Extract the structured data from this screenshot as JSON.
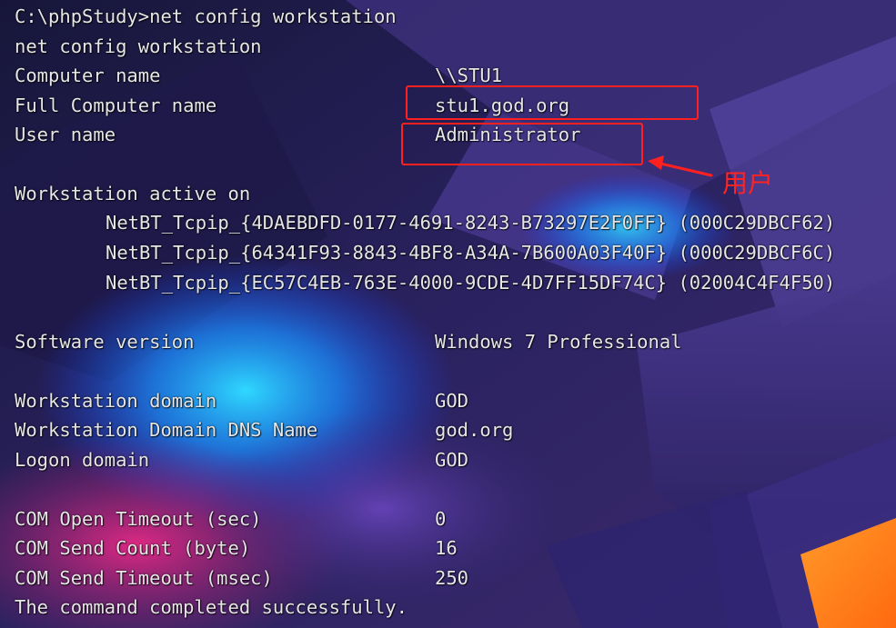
{
  "console": {
    "prompt": "C:\\phpStudy>net config workstation",
    "echo": "net config workstation",
    "rows": [
      {
        "label": "Computer name",
        "value": "\\\\STU1"
      },
      {
        "label": "Full Computer name",
        "value": "stu1.god.org"
      },
      {
        "label": "User name",
        "value": "Administrator"
      }
    ],
    "active_header": "Workstation active on",
    "adapters": [
      "NetBT_Tcpip_{4DAEBDFD-0177-4691-8243-B73297E2F0FF} (000C29DBCF62)",
      "NetBT_Tcpip_{64341F93-8843-4BF8-A34A-7B600A03F40F} (000C29DBCF6C)",
      "NetBT_Tcpip_{EC57C4EB-763E-4000-9CDE-4D7FF15DF74C} (02004C4F4F50)"
    ],
    "software": {
      "label": "Software version",
      "value": "Windows 7 Professional"
    },
    "domain_rows": [
      {
        "label": "Workstation domain",
        "value": "GOD"
      },
      {
        "label": "Workstation Domain DNS Name",
        "value": "god.org"
      },
      {
        "label": "Logon domain",
        "value": "GOD"
      }
    ],
    "com_rows": [
      {
        "label": "COM Open Timeout (sec)",
        "value": "0"
      },
      {
        "label": "COM Send Count (byte)",
        "value": "16"
      },
      {
        "label": "COM Send Timeout (msec)",
        "value": "250"
      }
    ],
    "result": "The command completed successfully."
  },
  "annotation": {
    "label": "用户",
    "color": "#ff2020"
  }
}
